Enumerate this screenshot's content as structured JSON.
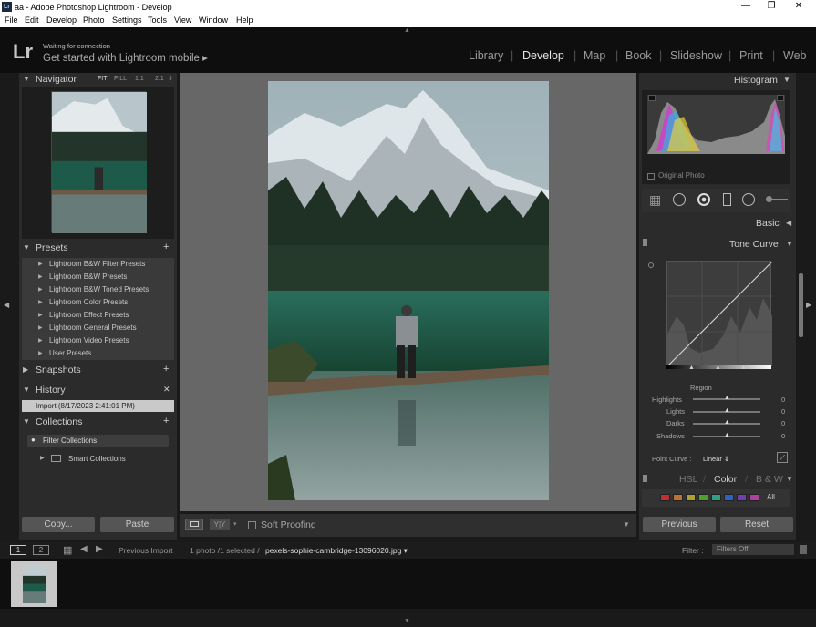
{
  "window": {
    "title": "aa - Adobe Photoshop Lightroom - Develop",
    "app_icon": "Lr"
  },
  "menu": [
    "File",
    "Edit",
    "Develop",
    "Photo",
    "Settings",
    "Tools",
    "View",
    "Window",
    "Help"
  ],
  "identity": {
    "logo": "Lr",
    "status": "Waiting for connection",
    "cta": "Get started with Lightroom mobile ▸"
  },
  "modules": [
    "Library",
    "Develop",
    "Map",
    "Book",
    "Slideshow",
    "Print",
    "Web"
  ],
  "navigator": {
    "title": "Navigator",
    "zoom": [
      "FIT",
      "FILL",
      "1:1",
      "2:1"
    ]
  },
  "presets": {
    "title": "Presets",
    "items": [
      "Lightroom B&W Filter Presets",
      "Lightroom B&W Presets",
      "Lightroom B&W Toned Presets",
      "Lightroom Color Presets",
      "Lightroom Effect Presets",
      "Lightroom General Presets",
      "Lightroom Video Presets",
      "User Presets"
    ]
  },
  "snapshots": {
    "title": "Snapshots"
  },
  "history": {
    "title": "History",
    "items": [
      "Import (8/17/2023 2:41:01 PM)"
    ]
  },
  "collections": {
    "title": "Collections",
    "filter": "Filter Collections",
    "items": [
      "Smart Collections"
    ]
  },
  "left_buttons": {
    "copy": "Copy...",
    "paste": "Paste"
  },
  "toolbar": {
    "soft_proofing": "Soft Proofing",
    "yy": "Y|Y"
  },
  "histogram": {
    "title": "Histogram",
    "original_photo": "Original Photo"
  },
  "basic": {
    "title": "Basic"
  },
  "tone_curve": {
    "title": "Tone Curve",
    "region": "Region",
    "sliders": [
      {
        "label": "Highlights",
        "value": "0"
      },
      {
        "label": "Lights",
        "value": "0"
      },
      {
        "label": "Darks",
        "value": "0"
      },
      {
        "label": "Shadows",
        "value": "0"
      }
    ],
    "point_curve_label": "Point Curve :",
    "point_curve_value": "Linear ⇕"
  },
  "hsl": {
    "tabs": [
      "HSL",
      "Color",
      "B & W"
    ],
    "all": "All",
    "swatches": [
      "#c03030",
      "#c07030",
      "#b0a030",
      "#50a030",
      "#30a080",
      "#3060c0",
      "#7040b0",
      "#b040a0"
    ]
  },
  "right_buttons": {
    "previous": "Previous",
    "reset": "Reset"
  },
  "filmstrip": {
    "screen1": "1",
    "screen2": "2",
    "source": "Previous Import",
    "count": "1 photo /1 selected /",
    "filename": "pexels-sophie-cambridge-13096020.jpg ▾",
    "filter_label": "Filter :",
    "filter_value": "Filters Off"
  }
}
